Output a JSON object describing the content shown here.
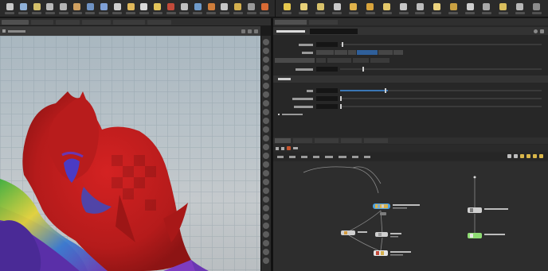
{
  "shelf": {
    "tools": [
      {
        "icon": "sphere-icon",
        "color": "#c9c9c9"
      },
      {
        "icon": "tube-icon",
        "color": "#8fb0d8"
      },
      {
        "icon": "grid-icon",
        "color": "#d4c06a"
      },
      {
        "icon": "curve-icon",
        "color": "#b9b9b9"
      },
      {
        "icon": "circle-icon",
        "color": "#b5b5b5"
      },
      {
        "icon": "torus-icon",
        "color": "#d0a060"
      },
      {
        "icon": "box-icon",
        "color": "#6f93c4"
      },
      {
        "icon": "platonic-icon",
        "color": "#7fa0d6"
      },
      {
        "icon": "line-icon",
        "color": "#cfcfcf"
      },
      {
        "icon": "spiral-icon",
        "color": "#e0b85a"
      },
      {
        "icon": "font-icon",
        "color": "#d9d9d9"
      },
      {
        "icon": "light-icon",
        "color": "#e4c55a"
      },
      {
        "icon": "null-icon",
        "color": "#c24a3a"
      },
      {
        "icon": "camera-icon",
        "color": "#c0c0c0"
      },
      {
        "icon": "wave-icon",
        "color": "#6e9bcb"
      },
      {
        "icon": "flag-icon",
        "color": "#cf7d3a"
      },
      {
        "icon": "gear-icon",
        "color": "#c5c5c5"
      },
      {
        "icon": "star-icon",
        "color": "#d4b04e"
      },
      {
        "icon": "smoke-icon",
        "color": "#9a9a9a"
      },
      {
        "icon": "flame-icon",
        "color": "#d86a34"
      }
    ],
    "tools_right": [
      {
        "icon": "sun-light-icon",
        "color": "#e6c84e"
      },
      {
        "icon": "point-light-icon",
        "color": "#e8d178"
      },
      {
        "icon": "spot-light-icon",
        "color": "#d9c26a"
      },
      {
        "icon": "area-light-icon",
        "color": "#c9c9c9"
      },
      {
        "icon": "env-light-icon",
        "color": "#e0b24a"
      },
      {
        "icon": "sky-light-icon",
        "color": "#d9a43c"
      },
      {
        "icon": "portal-light-icon",
        "color": "#e5c96a"
      },
      {
        "icon": "camera2-icon",
        "color": "#c8c8c8"
      },
      {
        "icon": "stereo-camera-icon",
        "color": "#bdbdbd"
      },
      {
        "icon": "ambient-light-icon",
        "color": "#ecd37e"
      },
      {
        "icon": "caustic-light-icon",
        "color": "#c9a142"
      },
      {
        "icon": "volume-light-icon",
        "color": "#cfcfcf"
      },
      {
        "icon": "geo-light-icon",
        "color": "#aaaaaa"
      },
      {
        "icon": "distant-light-icon",
        "color": "#d8bd5c"
      },
      {
        "icon": "indirect-light-icon",
        "color": "#b7b7b7"
      },
      {
        "icon": "shadow-icon",
        "color": "#8d8d8d"
      }
    ]
  },
  "viewport": {
    "surface_colors": {
      "red": "#c21e1e",
      "dark_red": "#8b1414",
      "blue": "#3c4bc0",
      "purple": "#6a36b2",
      "green": "#3fae3c",
      "yellow": "#e3d23a"
    }
  },
  "network": {
    "wire_color": "#8a8a8a",
    "highlight_color": "#3ea0e0"
  }
}
